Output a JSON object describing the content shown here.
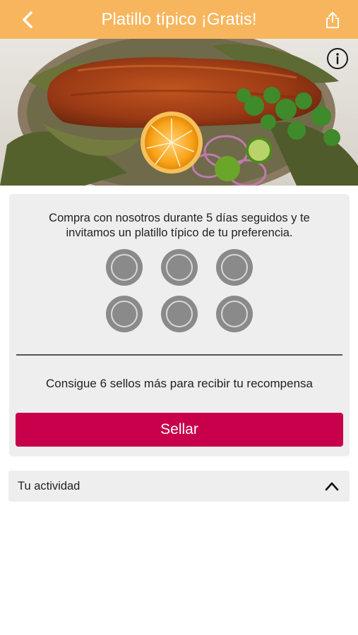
{
  "header": {
    "title": "Platillo típico ¡Gratis!",
    "back_icon": "chevron-left-icon",
    "share_icon": "share-icon",
    "color": "#f7b65d"
  },
  "hero": {
    "info_icon": "info-icon"
  },
  "card": {
    "description": "Compra con nosotros durante 5 días seguidos y te invitamos un platillo típico de tu preferencia.",
    "stamps_total": 6,
    "stamps_filled": 0,
    "goal_text": "Consigue 6 sellos más para recibir tu recompensa",
    "seal_button_label": "Sellar",
    "button_color": "#c8004b"
  },
  "activity": {
    "label": "Tu actividad",
    "toggle_icon": "chevron-up-icon"
  }
}
